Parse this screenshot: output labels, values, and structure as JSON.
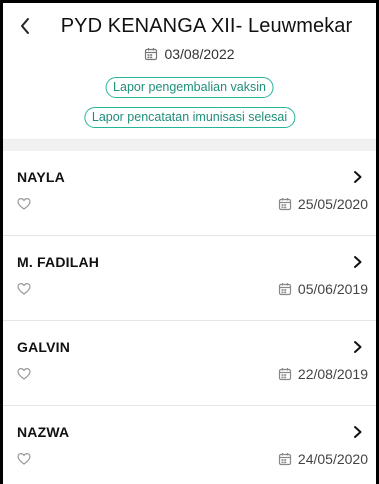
{
  "header": {
    "title": "PYD KENANGA XII- Leuwmekar",
    "date": "03/08/2022",
    "back_icon": "chevron-left-icon",
    "calendar_icon": "calendar-icon",
    "pill_color": "#26b59a",
    "buttons": [
      "Lapor pengembalian vaksin",
      "Lapor pencatatan imunisasi selesai"
    ]
  },
  "children": [
    {
      "name": "NAYLA",
      "dob": "25/05/2020"
    },
    {
      "name": "M. FADILAH",
      "dob": "05/06/2019"
    },
    {
      "name": "GALVIN",
      "dob": "22/08/2019"
    },
    {
      "name": "NAZWA",
      "dob": "24/05/2020"
    }
  ]
}
